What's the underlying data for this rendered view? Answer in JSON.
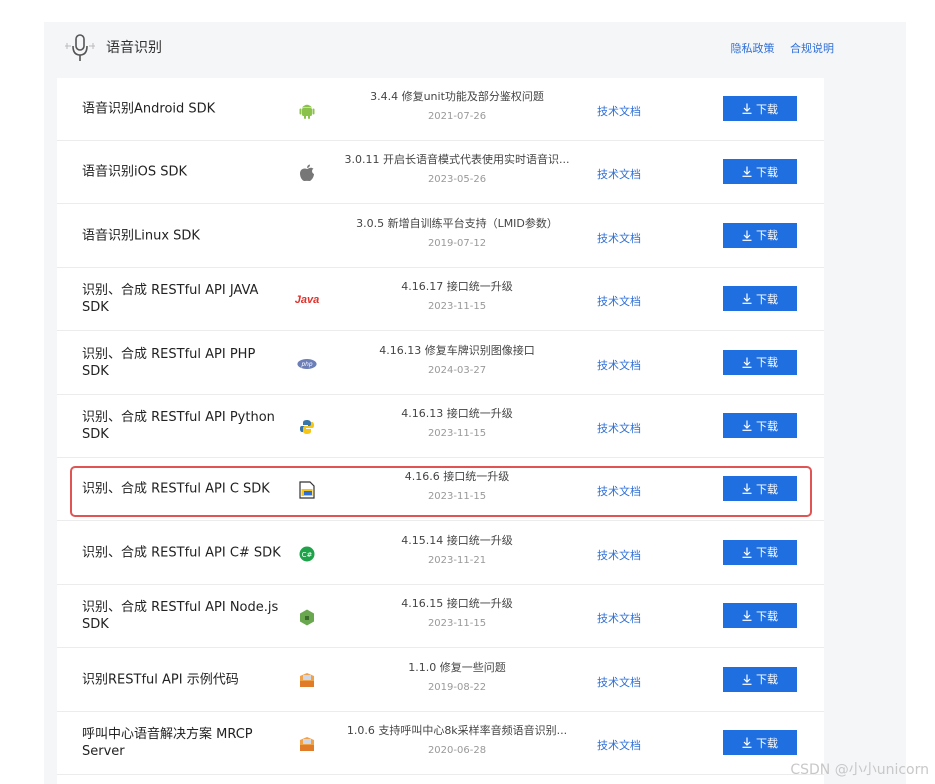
{
  "header": {
    "title": "语音识别",
    "privacy_label": "隐私政策",
    "compliance_label": "合规说明"
  },
  "colors": {
    "accent": "#1f6fe0",
    "link": "#2f6fd5",
    "highlight": "#e05454"
  },
  "rows": [
    {
      "name": "语音识别Android SDK",
      "icon": "android-icon",
      "version": "3.4.4 修复unit功能及部分鉴权问题",
      "date": "2021-07-26",
      "doc": "技术文档",
      "download": "下载"
    },
    {
      "name": "语音识别iOS SDK",
      "icon": "apple-icon",
      "version": "3.0.11 开启长语音模式代表使用实时语音识...",
      "date": "2023-05-26",
      "doc": "技术文档",
      "download": "下载"
    },
    {
      "name": "语音识别Linux SDK",
      "icon": "",
      "version": "3.0.5 新增自训练平台支持（LMID参数）",
      "date": "2019-07-12",
      "doc": "技术文档",
      "download": "下载"
    },
    {
      "name": "识别、合成 RESTful API JAVA SDK",
      "icon": "java-icon",
      "icon_text": "Java",
      "version": "4.16.17 接口统一升级",
      "date": "2023-11-15",
      "doc": "技术文档",
      "download": "下载"
    },
    {
      "name": "识别、合成 RESTful API PHP SDK",
      "icon": "php-icon",
      "icon_text": "php",
      "version": "4.16.13 修复车牌识别图像接口",
      "date": "2024-03-27",
      "doc": "技术文档",
      "download": "下载"
    },
    {
      "name": "识别、合成 RESTful API Python SDK",
      "icon": "python-icon",
      "version": "4.16.13 接口统一升级",
      "date": "2023-11-15",
      "doc": "技术文档",
      "download": "下载"
    },
    {
      "name": "识别、合成 RESTful API C SDK",
      "icon": "c-icon",
      "version": "4.16.6 接口统一升级",
      "date": "2023-11-15",
      "doc": "技术文档",
      "download": "下载"
    },
    {
      "name": "识别、合成 RESTful API C# SDK",
      "icon": "csharp-icon",
      "icon_text": "C#",
      "version": "4.15.14 接口统一升级",
      "date": "2023-11-21",
      "doc": "技术文档",
      "download": "下载"
    },
    {
      "name": "识别、合成 RESTful API Node.js SDK",
      "icon": "nodejs-icon",
      "version": "4.16.15 接口统一升级",
      "date": "2023-11-15",
      "doc": "技术文档",
      "download": "下载"
    },
    {
      "name": "识别RESTful API 示例代码",
      "icon": "package-icon",
      "version": "1.1.0 修复一些问题",
      "date": "2019-08-22",
      "doc": "技术文档",
      "download": "下载"
    },
    {
      "name": "呼叫中心语音解决方案 MRCP Server",
      "icon": "package-icon",
      "version": "1.0.6 支持呼叫中心8k采样率音频语音识别...",
      "date": "2020-06-28",
      "doc": "技术文档",
      "download": "下载"
    }
  ],
  "watermark": "CSDN @小小unicorn"
}
